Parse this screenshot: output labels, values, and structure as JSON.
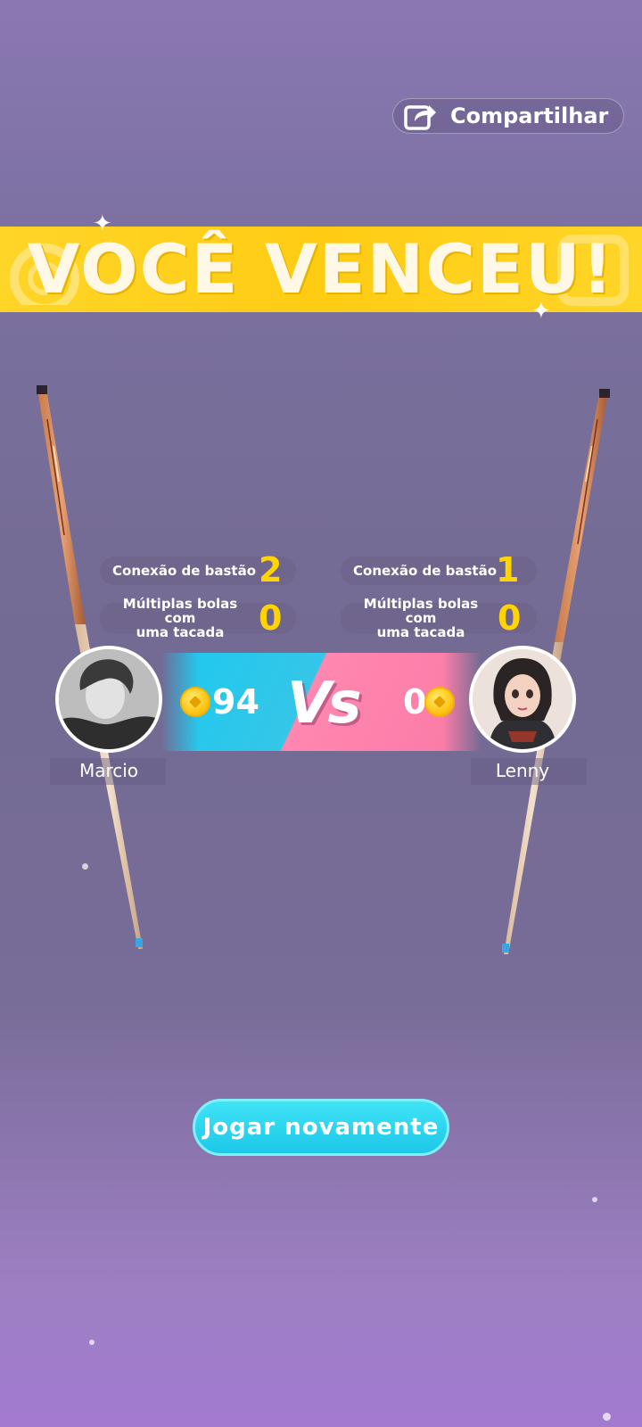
{
  "share": {
    "label": "Compartilhar",
    "icon": "share-icon"
  },
  "result": {
    "title": "VOCÊ VENCEU!"
  },
  "player_left": {
    "name": "Marcio",
    "coins": "94",
    "stats": [
      {
        "label": "Conexão de bastão",
        "value": "2"
      },
      {
        "label_line1": "Múltiplas bolas com",
        "label_line2": "uma tacada",
        "value": "0"
      }
    ]
  },
  "player_right": {
    "name": "Lenny",
    "coins": "0",
    "stats": [
      {
        "label": "Conexão de bastão",
        "value": "1"
      },
      {
        "label_line1": "Múltiplas bolas com",
        "label_line2": "uma tacada",
        "value": "0"
      }
    ]
  },
  "versus": {
    "label": "Vs"
  },
  "actions": {
    "play_again": "Jogar novamente"
  },
  "colors": {
    "banner": "#ffd528",
    "stat_value": "#ffd400",
    "play_button": "#1dc7e8",
    "vs_blue": "#1cc9f0",
    "vs_pink": "#f97aa6"
  }
}
